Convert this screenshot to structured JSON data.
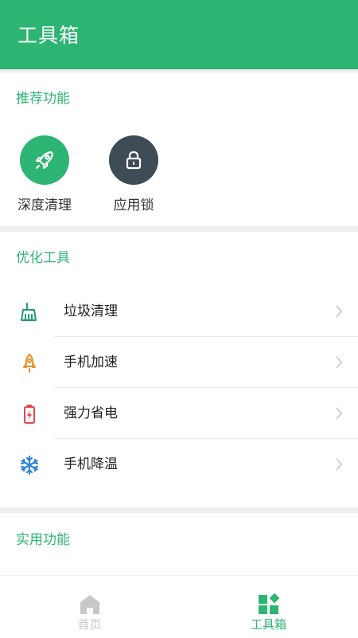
{
  "appbar": {
    "title": "工具箱"
  },
  "recommended": {
    "title": "推荐功能",
    "items": [
      {
        "label": "深度清理",
        "icon": "rocket-icon",
        "color": "#2db573"
      },
      {
        "label": "应用锁",
        "icon": "lock-icon",
        "color": "#3f4b55"
      }
    ]
  },
  "optimize": {
    "title": "优化工具",
    "items": [
      {
        "label": "垃圾清理",
        "icon": "broom-icon",
        "color": "#1f9a7a"
      },
      {
        "label": "手机加速",
        "icon": "rocket-outline-icon",
        "color": "#e8922e"
      },
      {
        "label": "强力省电",
        "icon": "battery-icon",
        "color": "#e5484d"
      },
      {
        "label": "手机降温",
        "icon": "snowflake-icon",
        "color": "#2f86d6"
      }
    ]
  },
  "utility": {
    "title": "实用功能"
  },
  "tabbar": {
    "tabs": [
      {
        "label": "首页",
        "icon": "home-icon",
        "active": false
      },
      {
        "label": "工具箱",
        "icon": "toolbox-icon",
        "active": true
      }
    ],
    "active_color": "#2db573",
    "inactive_color": "#c8c8c8"
  }
}
